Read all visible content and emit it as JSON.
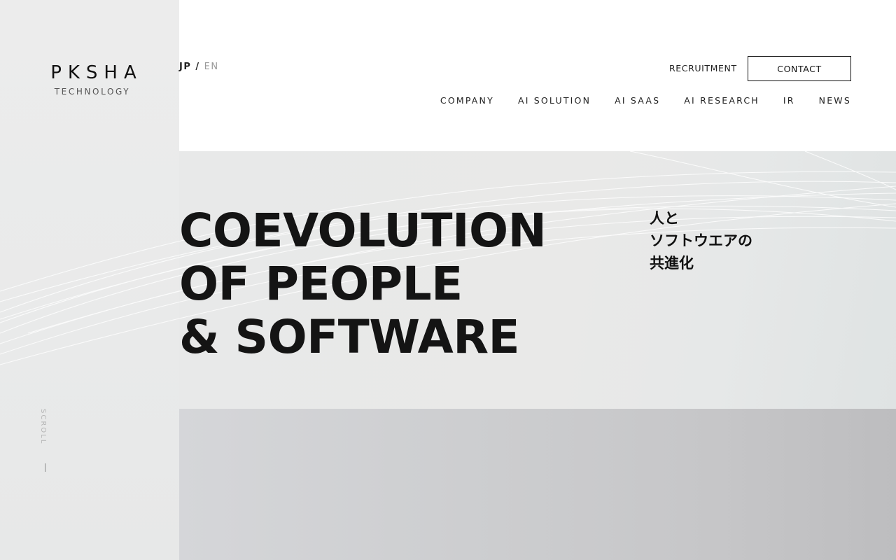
{
  "brand": {
    "name": "PKSHA",
    "sub": "TECHNOLOGY"
  },
  "lang": {
    "jp": "JP",
    "sep": "/",
    "en": "EN"
  },
  "utility": {
    "recruitment": "RECRUITMENT",
    "contact": "CONTACT"
  },
  "nav": [
    {
      "label": "COMPANY"
    },
    {
      "label": "AI SOLUTION"
    },
    {
      "label": "AI SAAS"
    },
    {
      "label": "AI RESEARCH"
    },
    {
      "label": "IR"
    },
    {
      "label": "NEWS"
    }
  ],
  "hero": {
    "headline": [
      "COEVOLUTION",
      "OF PEOPLE",
      "& SOFTWARE"
    ],
    "jp": [
      "人と",
      "ソフトウエアの",
      "共進化"
    ]
  },
  "scroll": {
    "label": "SCROLL"
  },
  "colors": {
    "text": "#141414",
    "header_bg": "#ffffff",
    "page_bg": "#e9eaea"
  }
}
